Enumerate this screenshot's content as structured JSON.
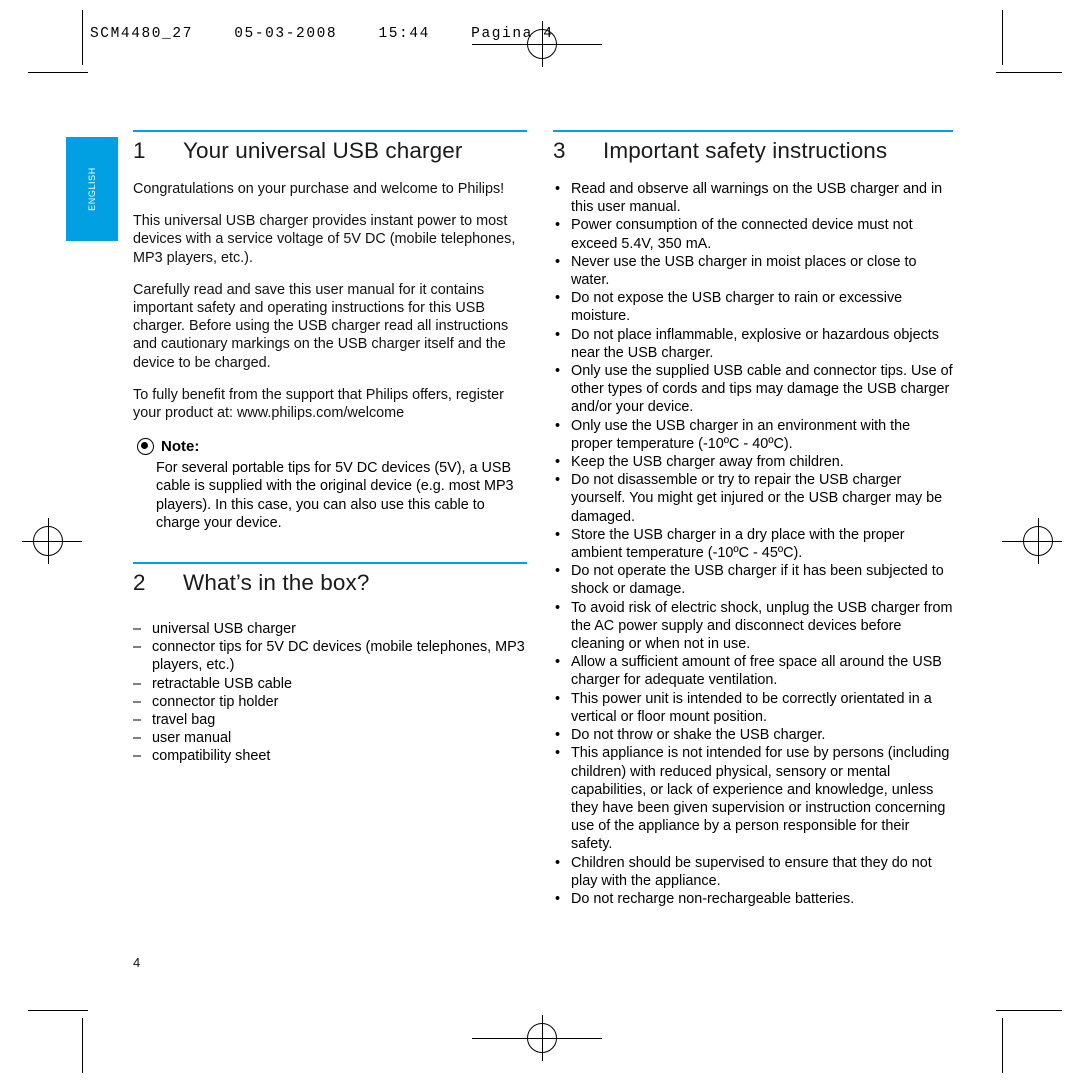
{
  "header": {
    "slug": "SCM4480_27    05-03-2008    15:44    Pagina 4"
  },
  "sidebar": {
    "language_tab": "ENGLISH",
    "tab_color": "#00a0e3"
  },
  "folio": "4",
  "sections": [
    {
      "number": "1",
      "title": "Your universal USB charger",
      "paragraphs": [
        "Congratulations on your purchase and welcome to Philips!",
        "This universal USB charger provides instant power to most devices with a service voltage of 5V DC (mobile telephones, MP3 players, etc.).",
        "Carefully read and save this user manual for it contains important safety and operating instructions for this USB charger. Before using the USB charger read all instructions and cautionary markings on the USB charger itself and the device to be charged.",
        "To fully benefit from the support that Philips offers, register your product at: www.philips.com/welcome"
      ],
      "note": {
        "icon": "note-icon",
        "label": "Note:",
        "text": "For several portable tips for 5V DC devices (5V), a USB cable is supplied with the original device (e.g. most MP3 players). In this case, you can also use this cable to charge your device."
      }
    },
    {
      "number": "2",
      "title": "What’s in the box?",
      "items": [
        "universal USB charger",
        "connector tips for 5V DC devices (mobile telephones, MP3 players, etc.)",
        "retractable USB cable",
        "connector tip holder",
        "travel bag",
        "user manual",
        "compatibility sheet"
      ]
    },
    {
      "number": "3",
      "title": "Important safety instructions",
      "items": [
        "Read and observe all warnings on the USB charger and in this user manual.",
        "Power consumption of the connected device must not exceed 5.4V, 350 mA.",
        "Never use the USB charger in moist places or close to water.",
        "Do not expose the USB charger to rain or excessive moisture.",
        "Do not place inflammable, explosive or hazardous objects near the USB charger.",
        "Only use the supplied USB cable and connector tips. Use of other types of cords and tips may damage the USB charger and/or your device.",
        "Only use the USB charger in an environment with the proper temperature (-10ºC - 40ºC).",
        "Keep the USB charger away from children.",
        "Do not disassemble or try to repair the USB charger yourself. You might get injured or the USB charger may be damaged.",
        "Store the USB charger in a dry place with the proper ambient temperature (-10ºC - 45ºC).",
        "Do not operate the USB charger if it has been subjected to shock or damage.",
        "To avoid risk of electric shock, unplug the USB charger from the AC power supply and disconnect devices before cleaning or when not in use.",
        "Allow a sufficient amount of free space all around the USB charger for adequate ventilation.",
        "This power unit is intended to be correctly orientated in a vertical or floor mount position.",
        "Do not throw or shake the USB charger.",
        "This appliance is not intended for use by persons (including children) with reduced physical, sensory or mental capabilities, or lack of experience and knowledge, unless they have been given supervision or instruction concerning use of the appliance by a person responsible for their safety.",
        "Children should be supervised to ensure that they do not play with the appliance.",
        "Do not recharge non-rechargeable batteries."
      ]
    }
  ]
}
